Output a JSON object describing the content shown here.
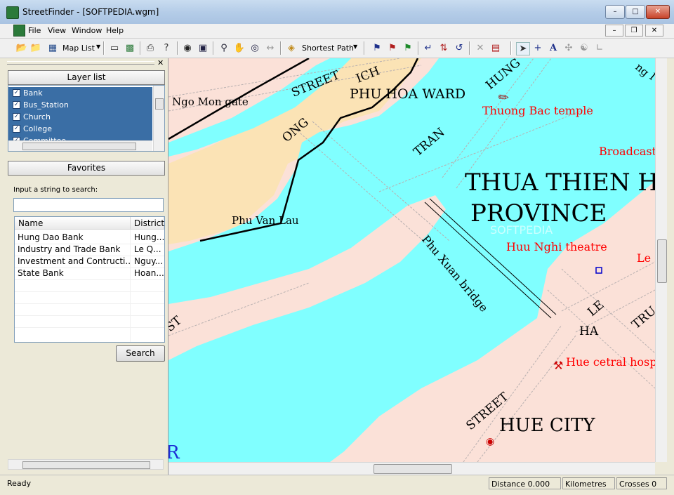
{
  "window": {
    "title": "StreetFinder - [SOFTPEDIA.wgm]"
  },
  "menu": {
    "items": [
      "File",
      "View",
      "Window",
      "Help"
    ]
  },
  "toolbar": {
    "map_list_label": "Map List",
    "shortest_path_label": "Shortest Path"
  },
  "layer_panel": {
    "header": "Layer list",
    "layers": [
      {
        "name": "Bank",
        "checked": true
      },
      {
        "name": "Bus_Station",
        "checked": true
      },
      {
        "name": "Church",
        "checked": true
      },
      {
        "name": "College",
        "checked": true
      },
      {
        "name": "Committee",
        "checked": true
      }
    ],
    "favorites_label": "Favorites",
    "search_label": "Input a string to search:",
    "search_value": "",
    "columns": [
      "Name",
      "District"
    ],
    "results": [
      {
        "name": "Hung Dao Bank",
        "district": "Hung..."
      },
      {
        "name": "Industry and Trade Bank",
        "district": "Le Q..."
      },
      {
        "name": "Investment and Contructi...",
        "district": "Nguy..."
      },
      {
        "name": "State Bank",
        "district": "Hoan..."
      }
    ],
    "search_button": "Search"
  },
  "map": {
    "labels": {
      "street1": "STREET",
      "ich": "ICH",
      "phu_hoa": "PHU HOA WARD",
      "hung": "HUNG",
      "ngo_mon": "Ngo Mon gate",
      "thuong_bac": "Thuong Bac temple",
      "ong": "ONG",
      "tran": "TRAN",
      "broadcast": "Broadcast",
      "thua_thien": "THUA THIEN HU",
      "province": "PROVINCE",
      "softpedia": "SOFTPEDIA",
      "phu_van_lau": "Phu Van Lau",
      "huu_nghi": "Huu Nghi theatre",
      "le_red": "Le",
      "phu_xuan": "Phu Xuan bridge",
      "le": "LE",
      "tru": "TRU",
      "ha": "HA",
      "hue_hosp": "Hue cetral hosp",
      "street2": "STREET",
      "hue_city": "HUE CITY",
      "ng_top": "ng",
      "i_top": "I",
      "st_left": "ST",
      "r_left": "R"
    },
    "colors": {
      "water": "#80ffff",
      "land": "#fbe1d8",
      "citadel": "#fbe3b5",
      "poi_text": "#ff0000"
    }
  },
  "status": {
    "left": "Ready",
    "distance": "Distance 0.000",
    "unit": "Kilometres",
    "crosses": "Crosses 0"
  }
}
